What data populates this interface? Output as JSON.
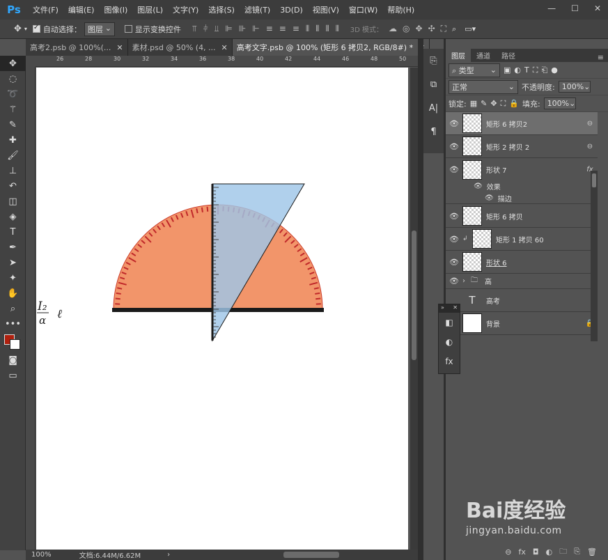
{
  "app": {
    "logo": "Ps"
  },
  "menu": [
    "文件(F)",
    "编辑(E)",
    "图像(I)",
    "图层(L)",
    "文字(Y)",
    "选择(S)",
    "滤镜(T)",
    "3D(D)",
    "视图(V)",
    "窗口(W)",
    "帮助(H)"
  ],
  "options": {
    "auto_select_label": "自动选择：",
    "auto_select_value": "图层",
    "transform_label": "显示变换控件",
    "mode_3d": "3D 模式："
  },
  "tabs": [
    {
      "label": "高考2.psb @ 100%(..."
    },
    {
      "label": "素材.psd @ 50% (4, ..."
    },
    {
      "label": "高考文字.psb @ 100% (矩形 6  拷贝2, RGB/8#) *"
    }
  ],
  "ruler_top": [
    "26",
    "28",
    "30",
    "32",
    "34",
    "36",
    "38",
    "40",
    "42",
    "44",
    "46",
    "48",
    "50"
  ],
  "status": {
    "zoom": "100%",
    "doc": "文档:6.44M/6.62M"
  },
  "canvas_text": {
    "formula_top": "I₂",
    "formula_bottom": "α",
    "formula_suffix": "ℓ"
  },
  "layers_panel": {
    "tabs": [
      "图层",
      "通道",
      "路径"
    ],
    "filter_label": "类型",
    "blend_mode": "正常",
    "opacity_label": "不透明度:",
    "opacity_value": "100%",
    "lock_label": "锁定:",
    "fill_label": "填充:",
    "fill_value": "100%",
    "effects_label": "效果",
    "stroke_label": "描边",
    "layers": [
      {
        "name": "矩形 6 拷贝2",
        "selected": true,
        "right": "⊖"
      },
      {
        "name": "矩形 2 拷贝 2",
        "selected": false,
        "right": "⊖"
      },
      {
        "name": "形状 7",
        "selected": false,
        "right": "fx"
      },
      {
        "name": "矩形 6 拷贝",
        "selected": false,
        "right": ""
      },
      {
        "name": "矩形 1 拷贝 60",
        "selected": false,
        "right": ""
      },
      {
        "name": "形状 6",
        "selected": false,
        "right": ""
      },
      {
        "name": "高",
        "selected": false,
        "right": ""
      },
      {
        "name": "高考",
        "selected": false,
        "right": ""
      },
      {
        "name": "背景",
        "selected": false,
        "right": "🔒"
      }
    ]
  },
  "watermark": {
    "logo": "Bai度经验",
    "url": "jingyan.baidu.com"
  }
}
